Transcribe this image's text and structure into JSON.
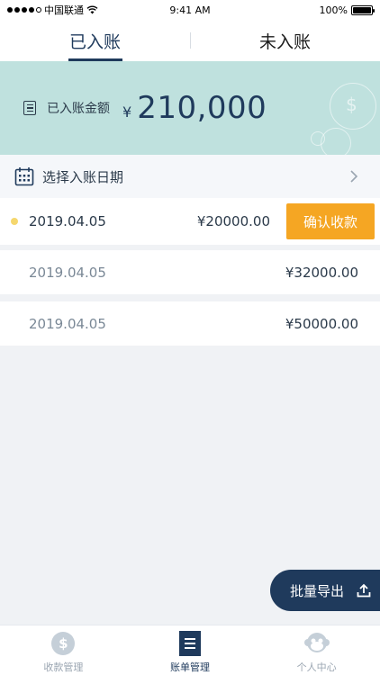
{
  "status_bar": {
    "carrier": "中国联通",
    "time": "9:41 AM",
    "battery": "100%"
  },
  "tabs": [
    {
      "label": "已入账",
      "active": true
    },
    {
      "label": "未入账",
      "active": false
    }
  ],
  "summary": {
    "label": "已入账金额",
    "currency": "¥",
    "amount": "210,000"
  },
  "date_picker": {
    "label": "选择入账日期"
  },
  "records": [
    {
      "date": "2019.04.05",
      "amount": "¥20000.00",
      "action": "确认收款",
      "highlighted": true
    },
    {
      "date": "2019.04.05",
      "amount": "¥32000.00"
    },
    {
      "date": "2019.04.05",
      "amount": "¥50000.00"
    }
  ],
  "export_button": {
    "label": "批量导出"
  },
  "bottom_nav": [
    {
      "label": "收款管理",
      "icon": "dollar-coin-icon",
      "active": false
    },
    {
      "label": "账单管理",
      "icon": "bill-list-icon",
      "active": true
    },
    {
      "label": "个人中心",
      "icon": "monkey-face-icon",
      "active": false
    }
  ],
  "colors": {
    "primary": "#1f3a5c",
    "accent": "#f5a623",
    "banner_bg": "#bfe1de",
    "pending_dot": "#f5d76e",
    "inactive": "#9aa5b1"
  }
}
